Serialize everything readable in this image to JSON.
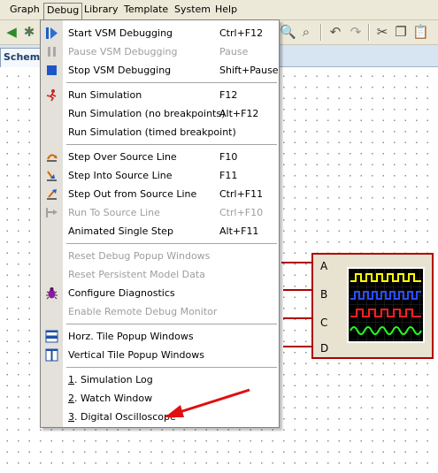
{
  "menubar": {
    "items": [
      "Graph",
      "Debug",
      "Library",
      "Template",
      "System",
      "Help"
    ]
  },
  "tab": {
    "label": "Schemat"
  },
  "debug_menu": {
    "groups": [
      [
        {
          "label": "Start VSM Debugging",
          "shortcut": "Ctrl+F12",
          "enabled": true,
          "icon": "play-icon"
        },
        {
          "label": "Pause VSM Debugging",
          "shortcut": "Pause",
          "enabled": false,
          "icon": "pause-icon"
        },
        {
          "label": "Stop VSM Debugging",
          "shortcut": "Shift+Pause",
          "enabled": true,
          "icon": "stop-icon"
        }
      ],
      [
        {
          "label": "Run Simulation",
          "shortcut": "F12",
          "enabled": true,
          "icon": "run-icon"
        },
        {
          "label": "Run Simulation (no breakpoints)",
          "shortcut": "Alt+F12",
          "enabled": true,
          "icon": ""
        },
        {
          "label": "Run Simulation (timed breakpoint)",
          "shortcut": "",
          "enabled": true,
          "icon": ""
        }
      ],
      [
        {
          "label": "Step Over Source Line",
          "shortcut": "F10",
          "enabled": true,
          "icon": "step-over-icon"
        },
        {
          "label": "Step Into Source Line",
          "shortcut": "F11",
          "enabled": true,
          "icon": "step-into-icon"
        },
        {
          "label": "Step Out from Source Line",
          "shortcut": "Ctrl+F11",
          "enabled": true,
          "icon": "step-out-icon"
        },
        {
          "label": "Run To Source Line",
          "shortcut": "Ctrl+F10",
          "enabled": false,
          "icon": "run-to-line-icon"
        },
        {
          "label": "Animated Single Step",
          "shortcut": "Alt+F11",
          "enabled": true,
          "icon": ""
        }
      ],
      [
        {
          "label": "Reset Debug Popup Windows",
          "shortcut": "",
          "enabled": false,
          "icon": ""
        },
        {
          "label": "Reset Persistent Model Data",
          "shortcut": "",
          "enabled": false,
          "icon": ""
        },
        {
          "label": "Configure Diagnostics",
          "shortcut": "",
          "enabled": true,
          "icon": "bug-icon"
        },
        {
          "label": "Enable Remote Debug Monitor",
          "shortcut": "",
          "enabled": false,
          "icon": ""
        }
      ],
      [
        {
          "label": "Horz. Tile Popup Windows",
          "shortcut": "",
          "enabled": true,
          "icon": "horz-tile-icon"
        },
        {
          "label": "Vertical Tile Popup Windows",
          "shortcut": "",
          "enabled": true,
          "icon": "vert-tile-icon"
        }
      ],
      [
        {
          "label": "1. Simulation Log",
          "shortcut": "",
          "enabled": true,
          "icon": ""
        },
        {
          "label": "2. Watch Window",
          "shortcut": "",
          "enabled": true,
          "icon": ""
        },
        {
          "label": "3. Digital Oscilloscope",
          "shortcut": "",
          "enabled": true,
          "icon": ""
        }
      ]
    ]
  },
  "oscilloscope": {
    "pins": [
      "A",
      "B",
      "C",
      "D"
    ],
    "trace_colors": [
      "#ffff00",
      "#2a4dff",
      "#ff2020",
      "#20ff20"
    ]
  },
  "colors": {
    "annotation_arrow": "#e01010",
    "component_border": "#b00000"
  }
}
